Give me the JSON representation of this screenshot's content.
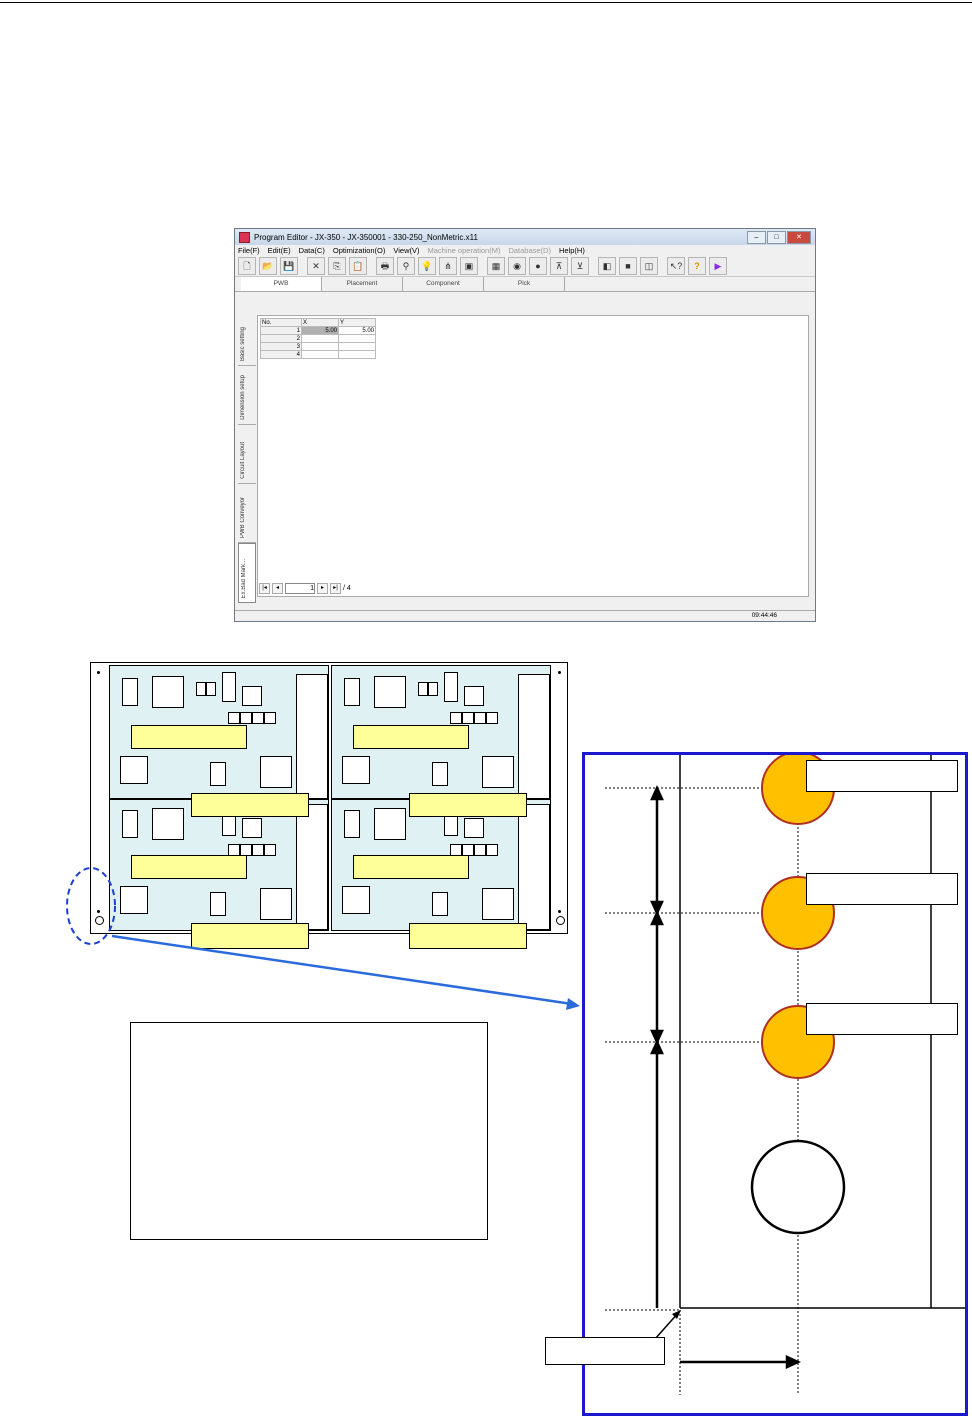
{
  "window": {
    "title": "Program Editor - JX-350 - JX-350001 - 330-250_NonMetric.x11",
    "buttons": {
      "minimize": "–",
      "maximize": "□",
      "close": "✕"
    }
  },
  "menu": [
    {
      "label": "File(F)",
      "enabled": true
    },
    {
      "label": "Edit(E)",
      "enabled": true
    },
    {
      "label": "Data(C)",
      "enabled": true
    },
    {
      "label": "Optimization(O)",
      "enabled": true
    },
    {
      "label": "View(V)",
      "enabled": true
    },
    {
      "label": "Machine operation(M)",
      "enabled": false
    },
    {
      "label": "Database(D)",
      "enabled": false
    },
    {
      "label": "Help(H)",
      "enabled": true
    }
  ],
  "toolbar_icons": [
    "new-file-icon",
    "open-folder-icon",
    "save-icon",
    "cut-icon",
    "copy-icon",
    "paste-icon",
    "print-icon",
    "find-icon",
    "lightbulb-icon",
    "tree-icon",
    "component-icon",
    "image-icon",
    "camera-icon",
    "sphere-icon",
    "align-left-icon",
    "align-center-icon",
    "layer-icon",
    "square-icon",
    "copy-layer-icon",
    "help-pointer-icon",
    "help-icon",
    "play-icon"
  ],
  "tabs": [
    "PWB",
    "Placement",
    "Component",
    "Pick"
  ],
  "side_tabs": [
    "Basic setting",
    "Dimension setup",
    "Circuit Layout",
    "PWB Conveyor",
    "Ex.Bad Mark..."
  ],
  "grid": {
    "headers": [
      "No.",
      "X",
      "Y"
    ],
    "rows": [
      {
        "no": "1",
        "x": "5.00",
        "y": "5.00"
      },
      {
        "no": "2",
        "x": "",
        "y": ""
      },
      {
        "no": "3",
        "x": "",
        "y": ""
      },
      {
        "no": "4",
        "x": "",
        "y": ""
      }
    ]
  },
  "pager": {
    "current": "1",
    "total": "/ 4"
  },
  "status": {
    "time": "09:44:46"
  },
  "colors": {
    "window_bg": "#f0f0f0",
    "board_fill": "#dff1f3",
    "label_fill": "#ffff99",
    "mark_fill": "#ffc000",
    "mark_stroke": "#b03020",
    "detail_border": "#1a1acc",
    "arrow_blue": "#2a6adc"
  }
}
